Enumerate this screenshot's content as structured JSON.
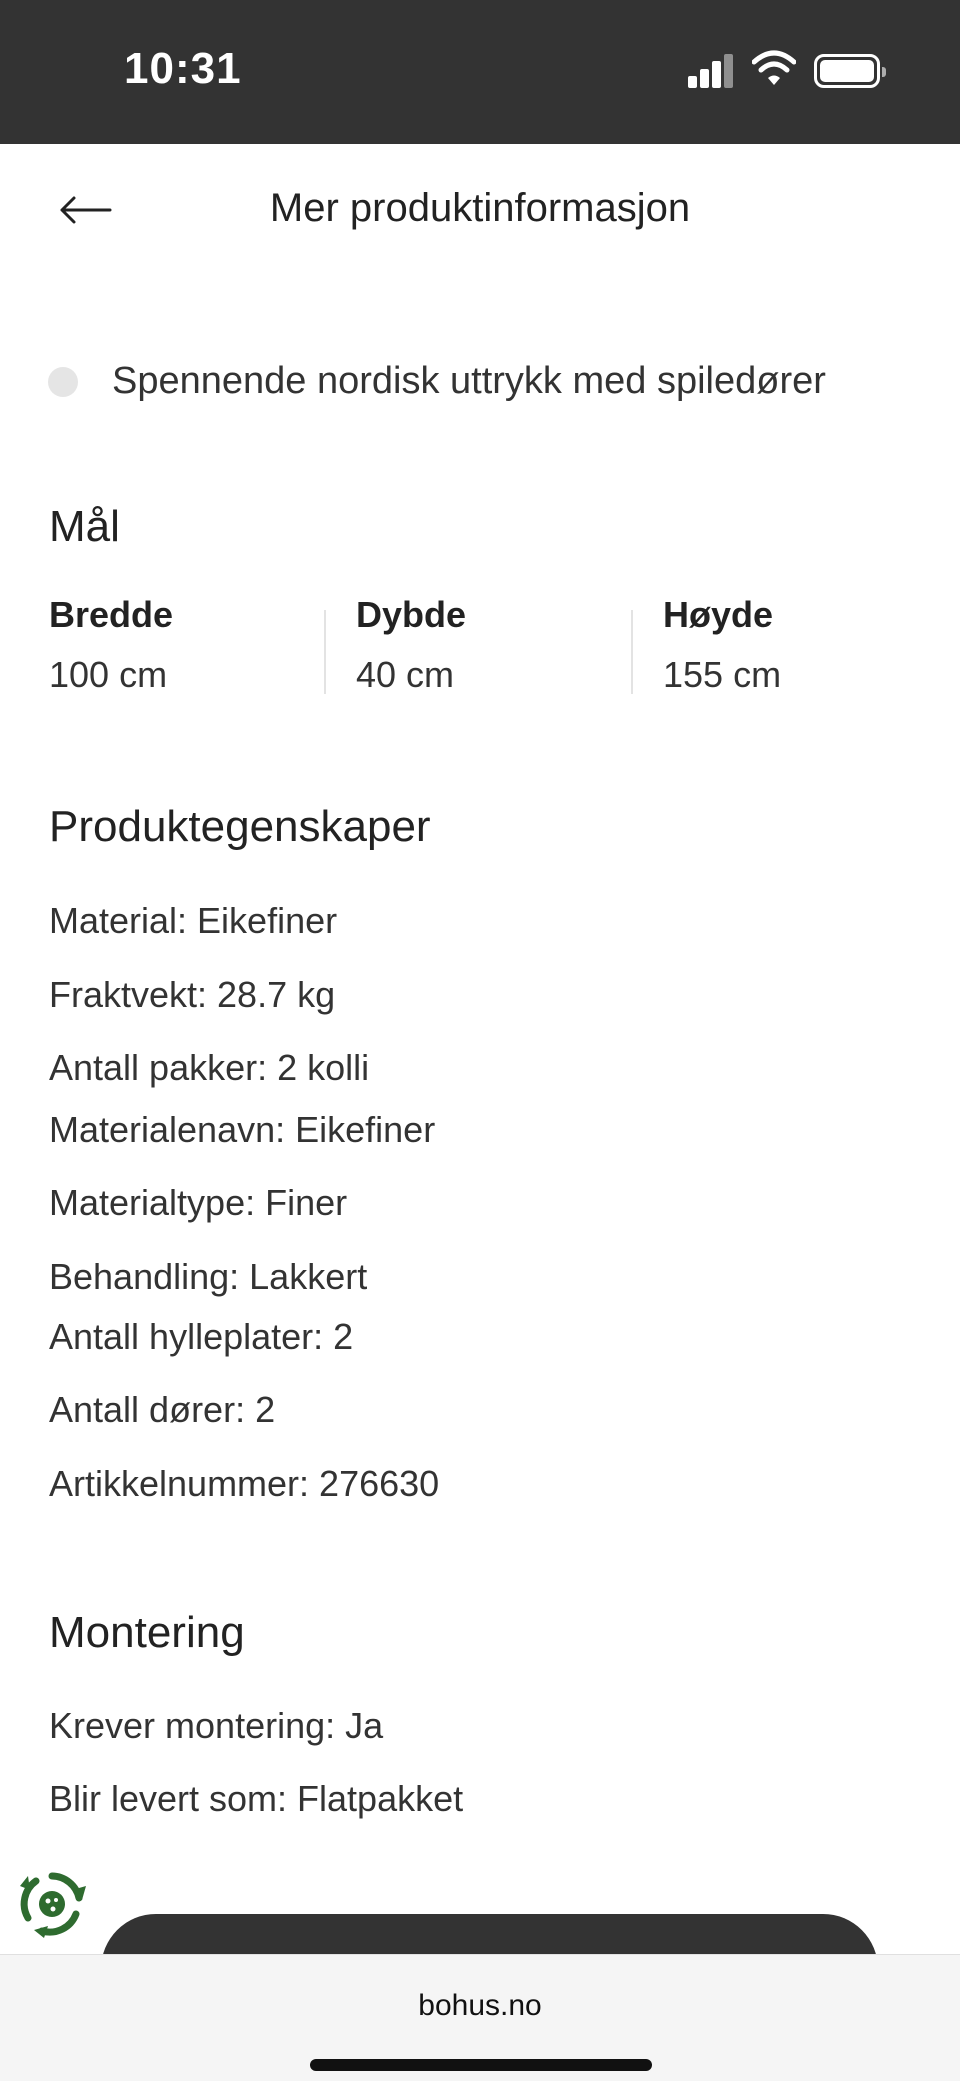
{
  "status_bar": {
    "time": "10:31"
  },
  "header": {
    "back_icon": "arrow-left-icon",
    "title": "Mer produktinformasjon"
  },
  "features": [
    "Spennende nordisk uttrykk med spiledører"
  ],
  "dimensions": {
    "title": "Mål",
    "items": [
      {
        "label": "Bredde",
        "value": "100 cm"
      },
      {
        "label": "Dybde",
        "value": "40 cm"
      },
      {
        "label": "Høyde",
        "value": "155 cm"
      }
    ]
  },
  "properties": {
    "title": "Produktegenskaper",
    "items": [
      "Material: Eikefiner",
      "Fraktvekt: 28.7 kg",
      "Antall pakker: 2 kolli",
      "Materialenavn: Eikefiner",
      "Materialtype: Finer",
      "Behandling: Lakkert",
      "Antall hylleplater: 2",
      "Antall dører: 2",
      "Artikkelnummer: 276630"
    ]
  },
  "assembly": {
    "title": "Montering",
    "items": [
      "Krever montering: Ja",
      "Blir levert som: Flatpakket"
    ]
  },
  "eco_badge": {
    "icon": "recycle-icon",
    "color": "#2e6b2f"
  },
  "browser": {
    "url": "bohus.no"
  },
  "colors": {
    "status_bar": "#333333",
    "text": "#222222",
    "cta": "#333333"
  }
}
